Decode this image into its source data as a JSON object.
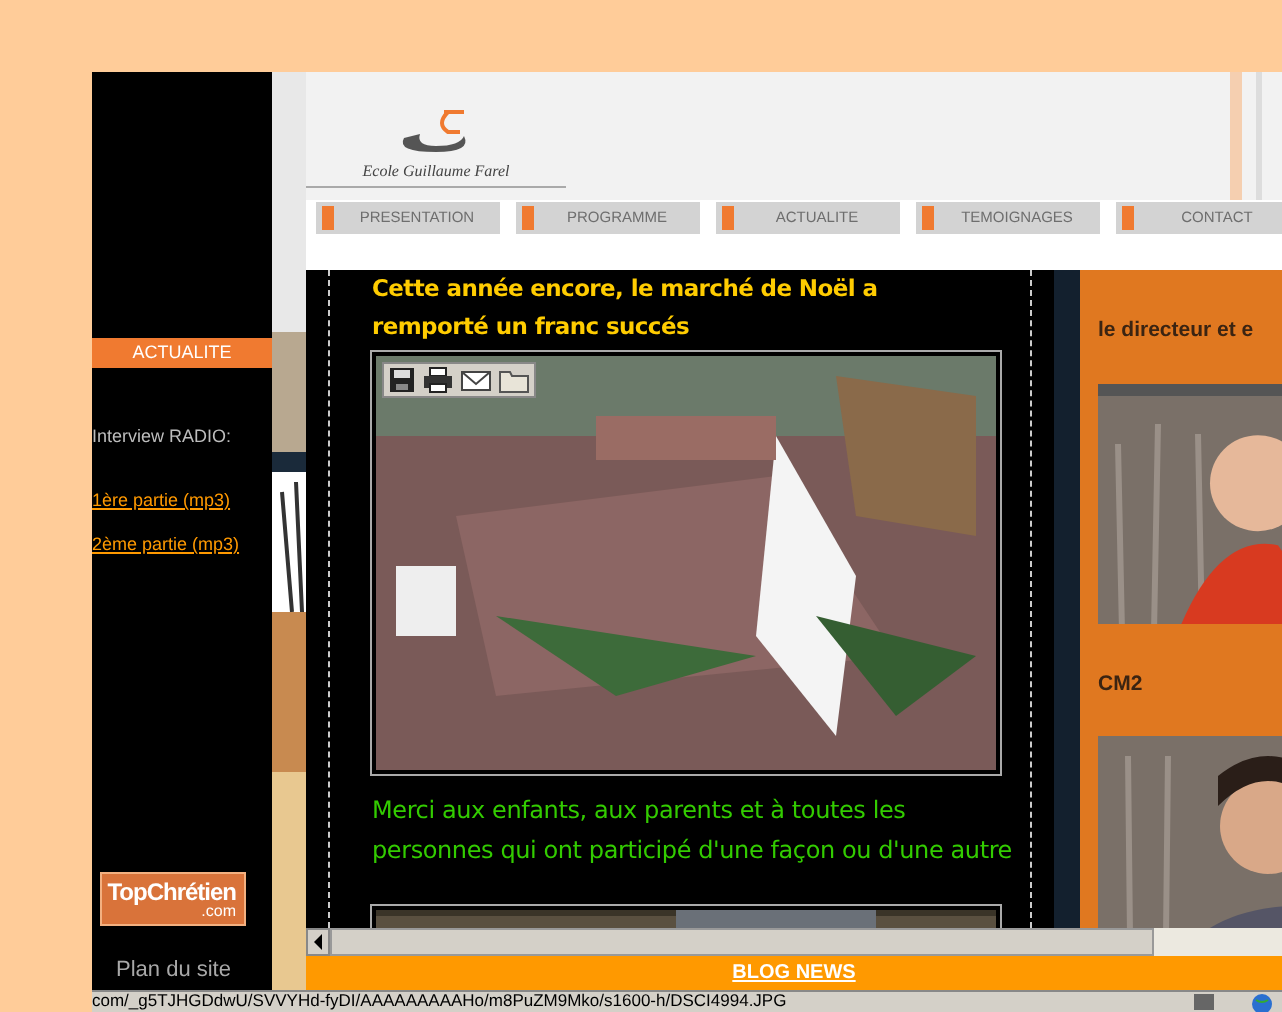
{
  "logo": {
    "text": "Ecole Guillaume Farel"
  },
  "nav": [
    {
      "label": "PRESENTATION"
    },
    {
      "label": "PROGRAMME"
    },
    {
      "label": "ACTUALITE"
    },
    {
      "label": "TEMOIGNAGES"
    },
    {
      "label": "CONTACT"
    }
  ],
  "sidebar": {
    "heading": "ACTUALITE",
    "text": "Interview RADIO:",
    "links": [
      "1ère partie (mp3)",
      "2ème partie (mp3)"
    ],
    "badge": {
      "main": "TopChrétien",
      "sub": ".com"
    },
    "footer_link": "Plan du site"
  },
  "post": {
    "title": "Cette année encore, le marché de Noël a remporté un franc succés",
    "caption": "Merci aux enfants, aux parents et à toutes les personnes qui ont participé d'une façon ou d'une autre"
  },
  "side_panel": {
    "items": [
      {
        "heading": "le directeur et e"
      },
      {
        "heading": "CM2"
      }
    ]
  },
  "footer_bar": {
    "link": "BLOG NEWS"
  },
  "status_bar": {
    "text": "com/_g5TJHGDdwU/SVVYHd-fyDI/AAAAAAAAAHo/m8PuZM9Mko/s1600-h/DSCI4994.JPG"
  }
}
